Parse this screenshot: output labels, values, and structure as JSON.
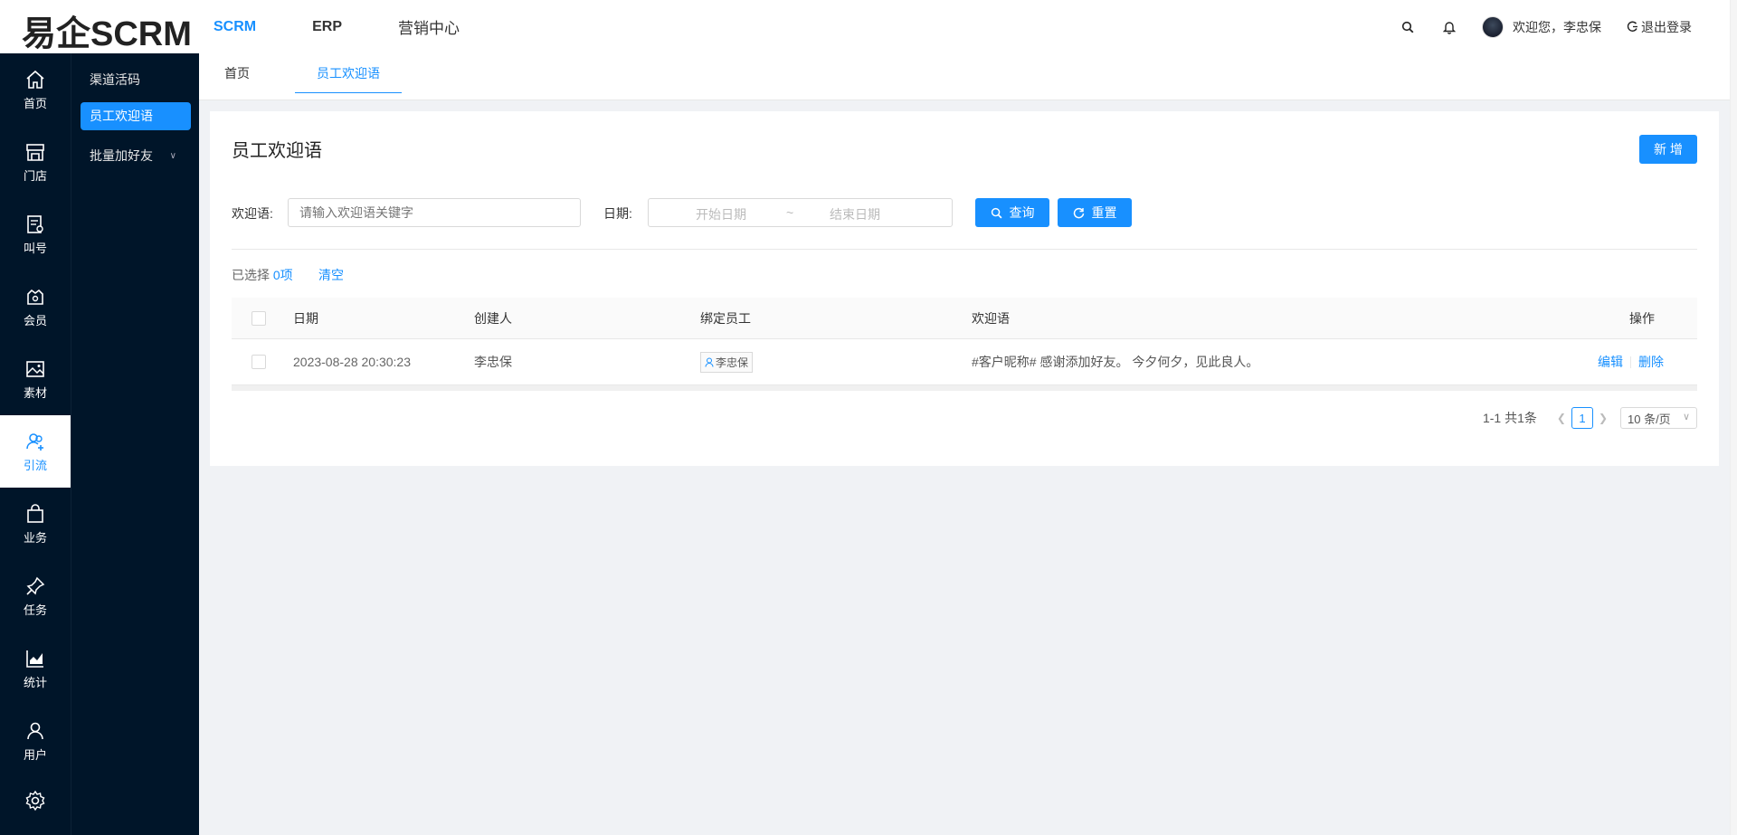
{
  "app": {
    "logo": "易企SCRM"
  },
  "topnav": [
    {
      "label": "SCRM",
      "active": true
    },
    {
      "label": "ERP",
      "active": false
    },
    {
      "label": "营销中心",
      "active": false
    }
  ],
  "header": {
    "welcome": "欢迎您，李忠保",
    "logout": "退出登录"
  },
  "iconbar": [
    {
      "label": "首页",
      "icon": "home-icon"
    },
    {
      "label": "门店",
      "icon": "store-icon"
    },
    {
      "label": "叫号",
      "icon": "queue-icon"
    },
    {
      "label": "会员",
      "icon": "member-icon"
    },
    {
      "label": "素材",
      "icon": "image-icon"
    },
    {
      "label": "引流",
      "icon": "user-add-icon",
      "active": true
    },
    {
      "label": "业务",
      "icon": "bag-icon"
    },
    {
      "label": "任务",
      "icon": "pin-icon"
    },
    {
      "label": "统计",
      "icon": "chart-icon"
    },
    {
      "label": "用户",
      "icon": "user-icon"
    }
  ],
  "subbar": [
    {
      "label": "渠道活码"
    },
    {
      "label": "员工欢迎语",
      "active": true
    },
    {
      "label": "批量加好友"
    }
  ],
  "tabs": [
    {
      "label": "首页"
    },
    {
      "label": "员工欢迎语",
      "active": true
    }
  ],
  "page": {
    "title": "员工欢迎语",
    "new_button": "新 增",
    "filter": {
      "keyword_label": "欢迎语:",
      "keyword_placeholder": "请输入欢迎语关键字",
      "date_label": "日期:",
      "start_placeholder": "开始日期",
      "range_sep": "~",
      "end_placeholder": "结束日期",
      "search_button": "查询",
      "reset_button": "重置"
    },
    "selection": {
      "prefix": "已选择",
      "count": "0项",
      "clear": "清空"
    },
    "table": {
      "columns": [
        "日期",
        "创建人",
        "绑定员工",
        "欢迎语",
        "操作"
      ],
      "rows": [
        {
          "date": "2023-08-28 20:30:23",
          "creator": "李忠保",
          "staff": "李忠保",
          "greeting": "#客户昵称# 感谢添加好友。 今夕何夕，见此良人。",
          "edit": "编辑",
          "delete": "删除"
        }
      ]
    },
    "pagination": {
      "total": "1-1 共1条",
      "current": "1",
      "page_size": "10 条/页"
    }
  }
}
